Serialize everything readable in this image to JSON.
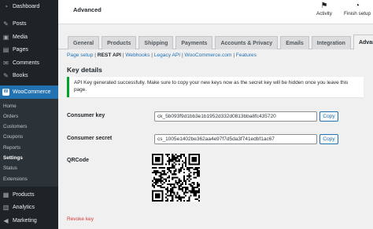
{
  "sidebar": {
    "top_items": [
      {
        "label": "Dashboard",
        "icon": "dashboard-icon",
        "glyph": "◔"
      }
    ],
    "items": [
      {
        "label": "Posts",
        "icon": "pushpin-icon",
        "glyph": "✎"
      },
      {
        "label": "Media",
        "icon": "media-icon",
        "glyph": "▣"
      },
      {
        "label": "Pages",
        "icon": "pages-icon",
        "glyph": "▤"
      },
      {
        "label": "Comments",
        "icon": "comment-icon",
        "glyph": "✉"
      },
      {
        "label": "Books",
        "icon": "pushpin-icon",
        "glyph": "✎"
      }
    ],
    "active": {
      "label": "WooCommerce",
      "icon": "woocommerce-icon",
      "glyph": "W"
    },
    "submenu": [
      "Home",
      "Orders",
      "Customers",
      "Coupons",
      "Reports",
      "Settings",
      "Status",
      "Extensions"
    ],
    "submenu_current": "Settings",
    "bottom_items": [
      {
        "label": "Products",
        "icon": "products-icon",
        "glyph": "▦"
      },
      {
        "label": "Analytics",
        "icon": "analytics-icon",
        "glyph": "▥"
      },
      {
        "label": "Marketing",
        "icon": "megaphone-icon",
        "glyph": "◀"
      }
    ]
  },
  "header": {
    "title": "Advanced",
    "activity_label": "Activity",
    "finish_setup_label": "Finish setup"
  },
  "tabs": [
    "General",
    "Products",
    "Shipping",
    "Payments",
    "Accounts & Privacy",
    "Emails",
    "Integration",
    "Advanced"
  ],
  "active_tab": "Advanced",
  "subnav": {
    "items": [
      "Page setup",
      "REST API",
      "Webhooks",
      "Legacy API",
      "WooCommerce.com",
      "Features"
    ],
    "current": "REST API"
  },
  "section_title": "Key details",
  "notice": "API Key generated successfully. Make sure to copy your new keys now as the secret key will be hidden once you leave this page.",
  "fields": {
    "consumer_key_label": "Consumer key",
    "consumer_key_value": "ck_5b093f9d1bb3e1b1952d332d0813bba8fc435720",
    "consumer_secret_label": "Consumer secret",
    "consumer_secret_value": "cs_1005e1402be362aa4e97f7d5da3f741edbf1ac67",
    "copy_label": "Copy",
    "qrcode_label": "QRCode"
  },
  "revoke_label": "Revoke key",
  "colors": {
    "sidebar_bg": "#1d2327",
    "accent": "#2271b1",
    "success": "#00a32a",
    "danger": "#d63638"
  }
}
